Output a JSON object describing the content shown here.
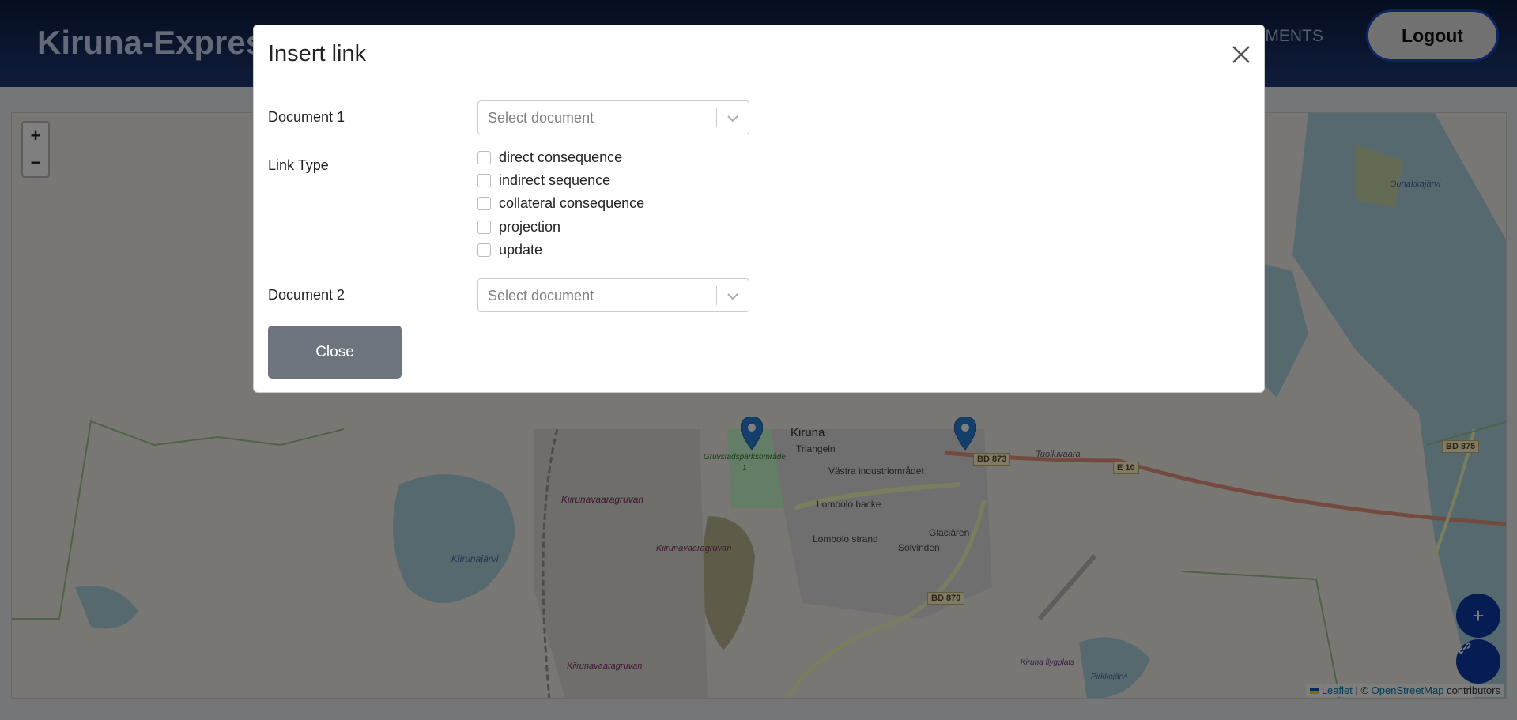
{
  "navbar": {
    "brand": "Kiruna-Express",
    "nav_link": "CUMENTS",
    "logout_label": "Logout"
  },
  "map": {
    "zoom_in": "+",
    "zoom_out": "−",
    "labels": {
      "kiruna": "Kiruna",
      "triangeln": "Triangeln",
      "vastra": "Västra industriområdet",
      "lombolo_backe": "Lombolo backe",
      "lombolo_strand": "Lombolo strand",
      "solvinden": "Solvinden",
      "glaciaren": "Glaciären",
      "gruvstad": "Gruvstadsparksområde",
      "gruvstad_num": "1",
      "kiirunavaara1": "Kiirunavaaragruvan",
      "kiirunavaara2": "Kiirunavaaragruvan",
      "kiirunavaara3": "Kiirunavaaragruvan",
      "kiirunajarvi": "Kiirunajärvi",
      "tuolluvaara": "Tuolluvaara",
      "ounakkajarvi": "Ounakkajärvi",
      "airport": "Kiruna flygplats",
      "pirkko": "Pirkkojärvi"
    },
    "roads": {
      "bd873": "BD 873",
      "e10": "E 10",
      "bd875": "BD 875",
      "bd870": "BD 870"
    },
    "attribution": {
      "leaflet": "Leaflet",
      "sep": " | © ",
      "osm": "OpenStreetMap",
      "contributors": " contributors"
    },
    "fab_add": "+"
  },
  "modal": {
    "title": "Insert link",
    "document1_label": "Document 1",
    "document1_placeholder": "Select document",
    "link_type_label": "Link Type",
    "link_types": [
      "direct consequence",
      "indirect sequence",
      "collateral consequence",
      "projection",
      "update"
    ],
    "document2_label": "Document 2",
    "document2_placeholder": "Select document",
    "close_button": "Close"
  },
  "colors": {
    "navbar": "#1f3a75",
    "logout_border": "#1c49c4",
    "fab": "#0d3aa8",
    "close_button": "#6c757d"
  }
}
